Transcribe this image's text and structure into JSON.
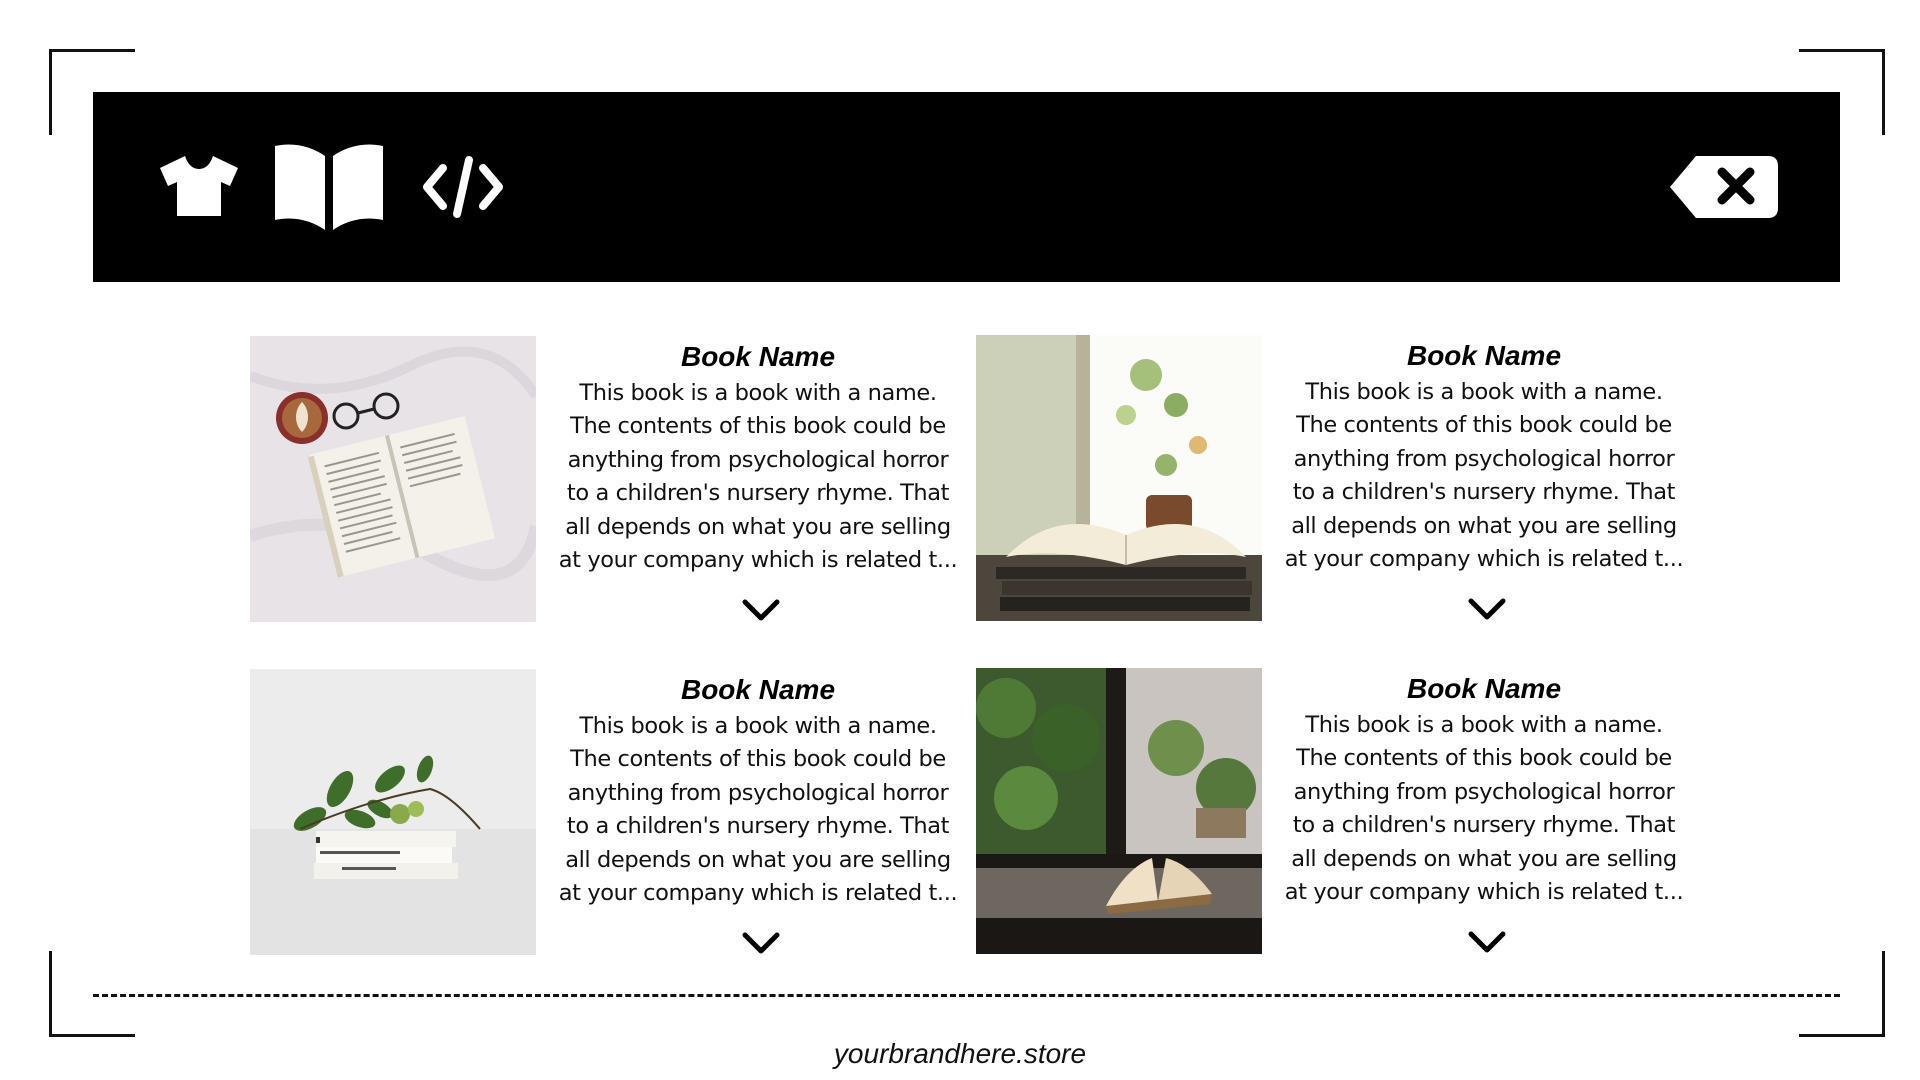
{
  "toolbar": {
    "icons": [
      "shirt-icon",
      "book-open-icon",
      "code-icon",
      "backspace-delete-icon"
    ],
    "bar_color": "#000000",
    "icon_color": "#ffffff"
  },
  "products": [
    {
      "title": "Book Name",
      "description": "This book is a book with a name.\nThe contents of this book could be\nanything from psychological horror\nto a children's nursery rhyme. That\nall depends on what you are selling\nat your company which is related t...",
      "image": "book-coffee-glasses-photo",
      "expand_icon": "chevron-down-icon"
    },
    {
      "title": "Book Name",
      "description": "This book is a book with a name.\nThe contents of this book could be\nanything from psychological horror\nto a children's nursery rhyme. That\nall depends on what you are selling\nat your company which is related t...",
      "image": "book-window-plant-photo",
      "expand_icon": "chevron-down-icon"
    },
    {
      "title": "Book Name",
      "description": "This book is a book with a name.\nThe contents of this book could be\nanything from psychological horror\nto a children's nursery rhyme. That\nall depends on what you are selling\nat your company which is related t...",
      "image": "books-stack-leaves-photo",
      "expand_icon": "chevron-down-icon"
    },
    {
      "title": "Book Name",
      "description": "This book is a book with a name.\nThe contents of this book could be\nanything from psychological horror\nto a children's nursery rhyme. That\nall depends on what you are selling\nat your company which is related t...",
      "image": "book-on-windowsill-photo",
      "expand_icon": "chevron-down-icon"
    }
  ],
  "footer": {
    "brand": "yourbrandhere.store"
  }
}
